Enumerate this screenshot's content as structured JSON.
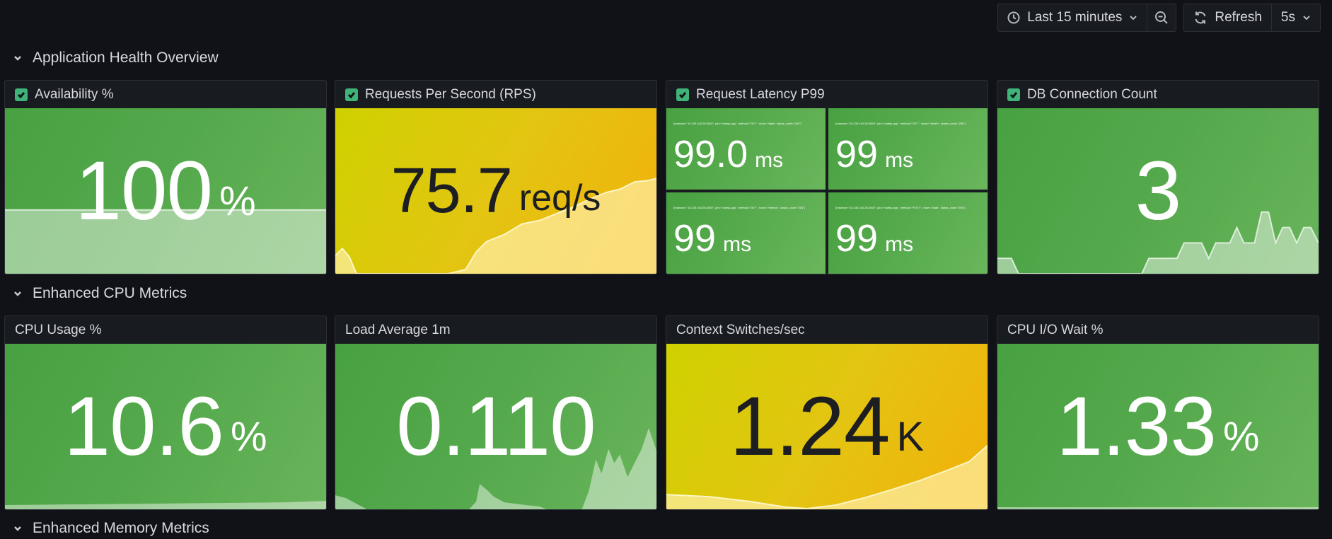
{
  "toolbar": {
    "time_range": "Last 15 minutes",
    "refresh_label": "Refresh",
    "refresh_interval": "5s"
  },
  "rows": [
    {
      "title": "Application Health Overview"
    },
    {
      "title": "Enhanced CPU Metrics"
    },
    {
      "title": "Enhanced Memory Metrics"
    }
  ],
  "panels": {
    "availability": {
      "title": "Availability %",
      "value": "100",
      "unit": "%",
      "color": "green"
    },
    "rps": {
      "title": "Requests Per Second (RPS)",
      "value": "75.7",
      "unit": "req/s",
      "color": "yellow"
    },
    "latency": {
      "title": "Request Latency P99",
      "cells": [
        {
          "label": "{instance=\"10.230.163.28:3000\", job=\"nodejs-app\", method=\"GET\", route=\"/data\", status_code=\"200\"}",
          "value": "99.0",
          "unit": "ms"
        },
        {
          "label": "{instance=\"10.230.163.28:3000\", job=\"nodejs-app\", method=\"GET\", route=\"/health\", status_code=\"200\"}",
          "value": "99",
          "unit": "ms"
        },
        {
          "label": "{instance=\"10.230.163.28:3000\", job=\"nodejs-app\", method=\"GET\", route=\"/metrics\", status_code=\"200\"}",
          "value": "99",
          "unit": "ms"
        },
        {
          "label": "{instance=\"10.230.163.28:3000\", job=\"nodejs-app\", method=\"POST\", route=\"/data\", status_code=\"200\"}",
          "value": "99",
          "unit": "ms"
        }
      ]
    },
    "db_conn": {
      "title": "DB Connection Count",
      "value": "3",
      "unit": "",
      "color": "green"
    },
    "cpu_usage": {
      "title": "CPU Usage %",
      "value": "10.6",
      "unit": "%",
      "color": "green"
    },
    "load_avg": {
      "title": "Load Average 1m",
      "value": "0.110",
      "unit": "",
      "color": "green"
    },
    "ctx_switch": {
      "title": "Context Switches/sec",
      "value": "1.24",
      "unit": "K",
      "color": "yellow"
    },
    "io_wait": {
      "title": "CPU I/O Wait %",
      "value": "1.33",
      "unit": "%",
      "color": "green"
    }
  },
  "colors": {
    "background": "#111217",
    "panel": "#181b1f",
    "ok_green": "#53a84b",
    "warn_yellow": "#e3c512",
    "checkbox": "#3fb378"
  }
}
